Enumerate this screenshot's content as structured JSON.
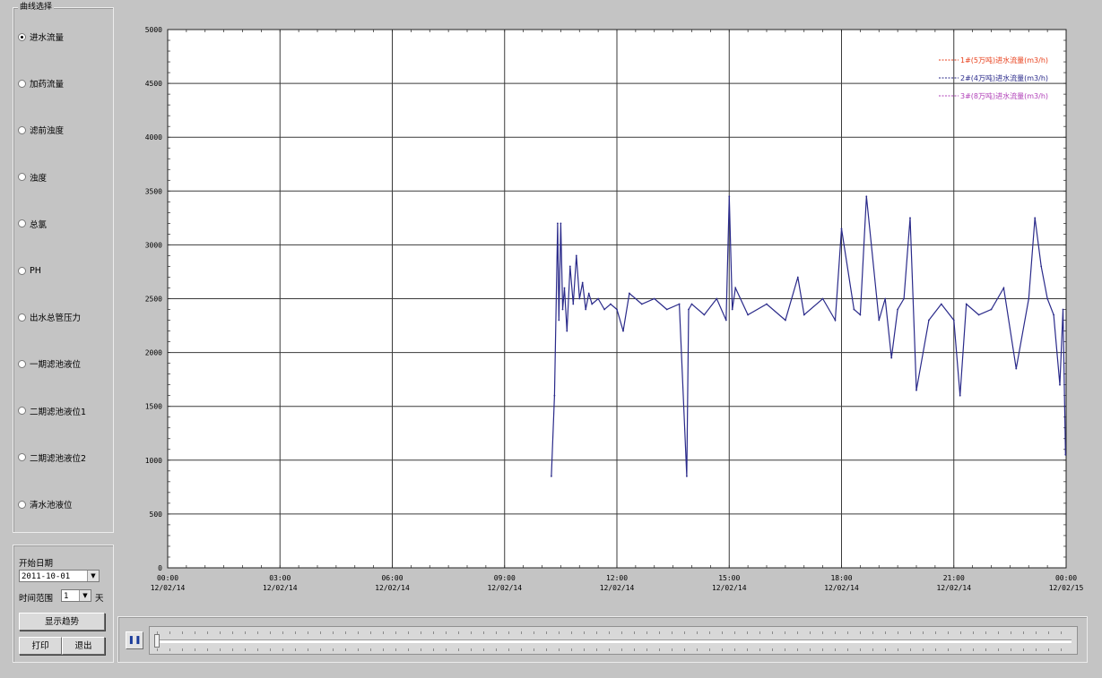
{
  "curve_group": {
    "title": "曲线选择",
    "options": [
      {
        "label": "进水流量",
        "checked": true
      },
      {
        "label": "加药流量",
        "checked": false
      },
      {
        "label": "滤前浊度",
        "checked": false
      },
      {
        "label": "浊度",
        "checked": false
      },
      {
        "label": "总氯",
        "checked": false
      },
      {
        "label": "PH",
        "checked": false
      },
      {
        "label": "出水总管压力",
        "checked": false
      },
      {
        "label": "一期滤池液位",
        "checked": false
      },
      {
        "label": "二期滤池液位1",
        "checked": false
      },
      {
        "label": "二期滤池液位2",
        "checked": false
      },
      {
        "label": "清水池液位",
        "checked": false
      }
    ]
  },
  "controls": {
    "start_date_label": "开始日期",
    "start_date_value": "2011-10-01",
    "range_label": "时间范围",
    "range_value": "1",
    "range_unit": "天",
    "show_trend_button": "显示趋势",
    "print_button": "打印",
    "exit_button": "退出"
  },
  "playback": {
    "pause_icon": "pause-icon",
    "pause_symbol": "❚❚",
    "position": 0
  },
  "chart_data": {
    "type": "line",
    "ylim": [
      0,
      5000
    ],
    "yticks": [
      0,
      500,
      1000,
      1500,
      2000,
      2500,
      3000,
      3500,
      4000,
      4500,
      5000
    ],
    "xlim": [
      "2014-12-02 00:00",
      "2014-12-03 00:00"
    ],
    "x_tick_labels": [
      [
        "00:00",
        "12/02/14"
      ],
      [
        "03:00",
        "12/02/14"
      ],
      [
        "06:00",
        "12/02/14"
      ],
      [
        "09:00",
        "12/02/14"
      ],
      [
        "12:00",
        "12/02/14"
      ],
      [
        "15:00",
        "12/02/14"
      ],
      [
        "18:00",
        "12/02/14"
      ],
      [
        "21:00",
        "12/02/14"
      ],
      [
        "00:00",
        "12/02/15"
      ]
    ],
    "grid": true,
    "legend_position": "top-right",
    "series": [
      {
        "name": "1#(5万吨)进水流量(m3/h)",
        "color": "#e8401c",
        "values": []
      },
      {
        "name": "2#(4万吨)进水流量(m3/h)",
        "color": "#2a2a8a",
        "x": [
          "10:15",
          "10:20",
          "10:25",
          "10:27",
          "10:30",
          "10:33",
          "10:36",
          "10:40",
          "10:45",
          "10:50",
          "10:55",
          "11:00",
          "11:05",
          "11:10",
          "11:15",
          "11:20",
          "11:30",
          "11:40",
          "11:50",
          "12:00",
          "12:10",
          "12:20",
          "12:40",
          "13:00",
          "13:20",
          "13:40",
          "13:52",
          "13:55",
          "14:00",
          "14:20",
          "14:40",
          "14:55",
          "15:00",
          "15:05",
          "15:10",
          "15:30",
          "16:00",
          "16:30",
          "16:50",
          "17:00",
          "17:30",
          "17:50",
          "18:00",
          "18:20",
          "18:30",
          "18:40",
          "19:00",
          "19:10",
          "19:20",
          "19:30",
          "19:40",
          "19:50",
          "20:00",
          "20:20",
          "20:40",
          "21:00",
          "21:10",
          "21:20",
          "21:40",
          "22:00",
          "22:20",
          "22:40",
          "23:00",
          "23:10",
          "23:20",
          "23:30",
          "23:40",
          "23:50",
          "23:55",
          "23:59"
        ],
        "values": [
          850,
          1600,
          3200,
          2300,
          3200,
          2400,
          2600,
          2200,
          2800,
          2450,
          2900,
          2500,
          2650,
          2400,
          2550,
          2450,
          2500,
          2400,
          2450,
          2400,
          2200,
          2550,
          2450,
          2500,
          2400,
          2450,
          850,
          2400,
          2450,
          2350,
          2500,
          2300,
          3450,
          2400,
          2600,
          2350,
          2450,
          2300,
          2700,
          2350,
          2500,
          2300,
          3150,
          2400,
          2350,
          3450,
          2300,
          2500,
          1950,
          2400,
          2500,
          3250,
          1650,
          2300,
          2450,
          2300,
          1600,
          2450,
          2350,
          2400,
          2600,
          1850,
          2500,
          3250,
          2800,
          2500,
          2350,
          1700,
          2400,
          1050
        ]
      },
      {
        "name": "3#(8万吨)进水流量(m3/h)",
        "color": "#b040b8",
        "values": []
      }
    ]
  }
}
